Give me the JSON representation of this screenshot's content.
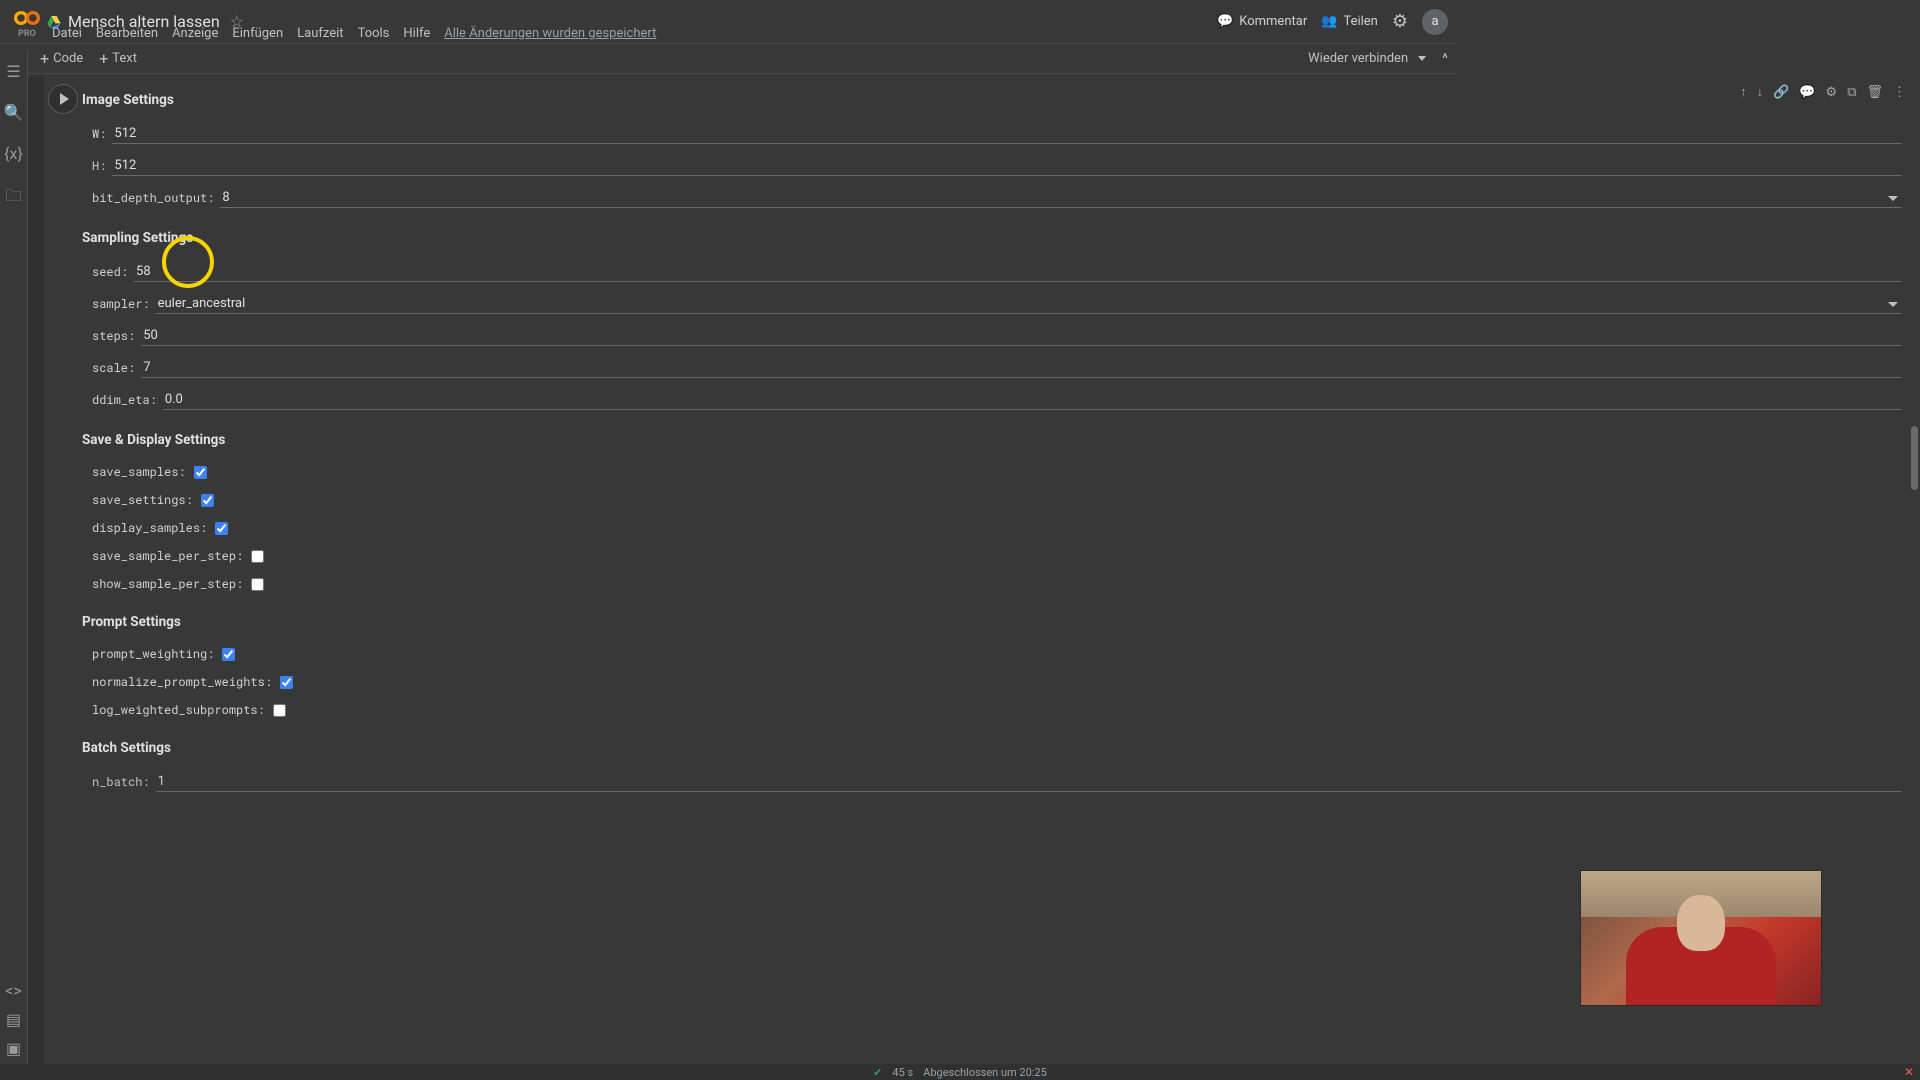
{
  "brand": {
    "pro": "PRO"
  },
  "doc": {
    "title": "Mensch altern lassen"
  },
  "menu": {
    "items": [
      "Datei",
      "Bearbeiten",
      "Anzeige",
      "Einfügen",
      "Laufzeit",
      "Tools",
      "Hilfe"
    ],
    "save_status": "Alle Änderungen wurden gespeichert"
  },
  "header": {
    "kommentar": "Kommentar",
    "teilen": "Teilen",
    "avatar": "a"
  },
  "toolbar": {
    "code": "Code",
    "text": "Text",
    "reconnect": "Wieder verbinden"
  },
  "cell_actions": {
    "up": "↑",
    "down": "↓",
    "link": "⛓",
    "comment": "💬",
    "settings": "⚙",
    "mirror": "⧉",
    "delete": "🗑",
    "more": "⋮"
  },
  "sections": {
    "image": "Image Settings",
    "sampling": "Sampling Settings",
    "save": "Save & Display Settings",
    "prompt": "Prompt Settings",
    "batch": "Batch Settings"
  },
  "fields": {
    "W": {
      "label": "W:",
      "value": "512"
    },
    "H": {
      "label": "H:",
      "value": "512"
    },
    "bit_depth_output": {
      "label": "bit_depth_output:",
      "value": "8"
    },
    "seed": {
      "label": "seed:",
      "value": "58"
    },
    "sampler": {
      "label": "sampler:",
      "value": "euler_ancestral"
    },
    "steps": {
      "label": "steps:",
      "value": "50"
    },
    "scale": {
      "label": "scale:",
      "value": "7"
    },
    "ddim_eta": {
      "label": "ddim_eta:",
      "value": "0.0"
    },
    "save_samples": {
      "label": "save_samples:",
      "checked": true
    },
    "save_settings": {
      "label": "save_settings:",
      "checked": true
    },
    "display_samples": {
      "label": "display_samples:",
      "checked": true
    },
    "save_sample_per_step": {
      "label": "save_sample_per_step:",
      "checked": false
    },
    "show_sample_per_step": {
      "label": "show_sample_per_step:",
      "checked": false
    },
    "prompt_weighting": {
      "label": "prompt_weighting:",
      "checked": true
    },
    "normalize_prompt_weights": {
      "label": "normalize_prompt_weights:",
      "checked": true
    },
    "log_weighted_subprompts": {
      "label": "log_weighted_subprompts:",
      "checked": false
    },
    "n_batch": {
      "label": "n_batch:",
      "value": "1"
    }
  },
  "footer": {
    "duration": "45 s",
    "done_at": "Abgeschlossen um 20:25"
  }
}
